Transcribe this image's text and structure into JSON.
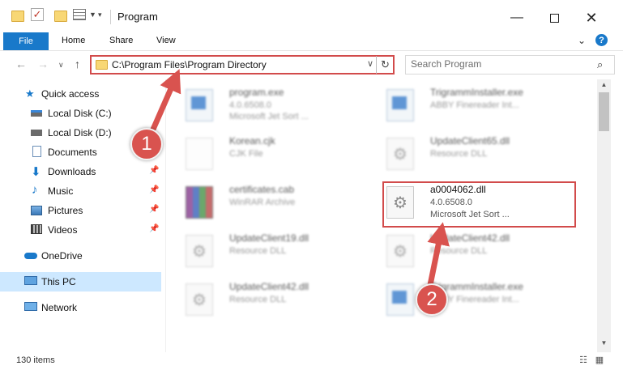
{
  "window": {
    "title": "Program",
    "minimize_icon": "minimize-icon",
    "maximize_icon": "maximize-icon",
    "close_icon": "close-icon"
  },
  "ribbon": {
    "tabs": [
      {
        "label": "File"
      },
      {
        "label": "Home"
      },
      {
        "label": "Share"
      },
      {
        "label": "View"
      }
    ]
  },
  "address": {
    "path": "C:\\Program Files\\Program Directory",
    "search_placeholder": "Search Program"
  },
  "sidebar": {
    "items": [
      {
        "label": "Quick access",
        "icon": "star-icon"
      },
      {
        "label": "Local Disk (C:)",
        "icon": "drive-icon"
      },
      {
        "label": "Local Disk (D:)",
        "icon": "drive-icon"
      },
      {
        "label": "Documents",
        "icon": "documents-icon"
      },
      {
        "label": "Downloads",
        "icon": "download-icon"
      },
      {
        "label": "Music",
        "icon": "music-icon"
      },
      {
        "label": "Pictures",
        "icon": "pictures-icon"
      },
      {
        "label": "Videos",
        "icon": "videos-icon"
      },
      {
        "label": "OneDrive",
        "icon": "cloud-icon"
      },
      {
        "label": "This PC",
        "icon": "computer-icon"
      },
      {
        "label": "Network",
        "icon": "network-icon"
      }
    ]
  },
  "files": [
    {
      "name": "program.exe",
      "line1": "4.0.6508.0",
      "line2": "Microsoft Jet Sort ...",
      "icon": "exe-icon"
    },
    {
      "name": "TrigrammInstaller.exe",
      "line1": "ABBY Finereader Int...",
      "line2": "",
      "icon": "exe-icon"
    },
    {
      "name": "Korean.cjk",
      "line1": "CJK File",
      "line2": "",
      "icon": "document-icon"
    },
    {
      "name": "UpdateClient65.dll",
      "line1": "Resource DLL",
      "line2": "",
      "icon": "dll-gear-icon"
    },
    {
      "name": "certificates.cab",
      "line1": "WinRAR Archive",
      "line2": "",
      "icon": "archive-icon"
    },
    {
      "name": "a0004062.dll",
      "line1": "4.0.6508.0",
      "line2": "Microsoft Jet Sort ...",
      "icon": "dll-gear-icon"
    },
    {
      "name": "UpdateClient19.dll",
      "line1": "Resource DLL",
      "line2": "",
      "icon": "dll-gear-icon"
    },
    {
      "name": "UpdateClient42.dll",
      "line1": "Resource DLL",
      "line2": "",
      "icon": "dll-gear-icon"
    },
    {
      "name": "UpdateClient42.dll",
      "line1": "Resource DLL",
      "line2": "",
      "icon": "dll-gear-icon"
    },
    {
      "name": "TrigrammInstaller.exe",
      "line1": "ABBY Finereader Int...",
      "line2": "",
      "icon": "exe-icon"
    }
  ],
  "status": {
    "items_count": "130 items"
  },
  "annotations": {
    "step1": "1",
    "step2": "2",
    "color": "#d9534f"
  }
}
